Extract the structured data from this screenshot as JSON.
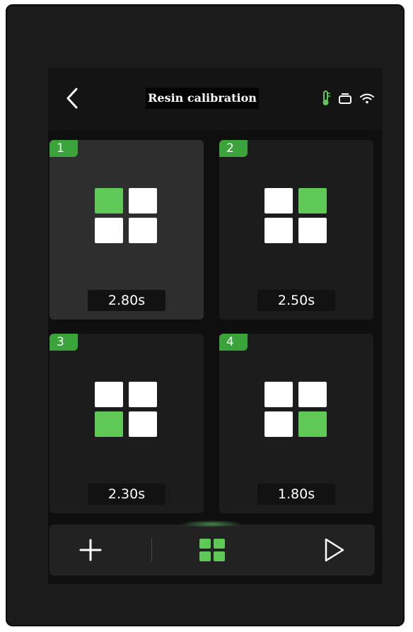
{
  "header": {
    "title": "Resin calibration",
    "back_icon": "chevron-left-icon",
    "status_icons": [
      "thermometer-icon",
      "printer-icon",
      "wifi-icon"
    ]
  },
  "tiles": [
    {
      "number": "1",
      "time": "2.80s",
      "selected": true,
      "pattern_on": [
        0
      ]
    },
    {
      "number": "2",
      "time": "2.50s",
      "selected": false,
      "pattern_on": [
        1
      ]
    },
    {
      "number": "3",
      "time": "2.30s",
      "selected": false,
      "pattern_on": [
        2
      ]
    },
    {
      "number": "4",
      "time": "1.80s",
      "selected": false,
      "pattern_on": [
        3
      ]
    }
  ],
  "bottom_bar": {
    "buttons": [
      "add-icon",
      "grid-icon",
      "play-icon"
    ],
    "active": "grid-icon"
  },
  "colors": {
    "accent": "#5fc957",
    "badge": "#3aa43a",
    "tile_bg": "#1c1c1c",
    "tile_selected_bg": "#2e2e2e",
    "screen_bg": "#0f0f0f"
  }
}
